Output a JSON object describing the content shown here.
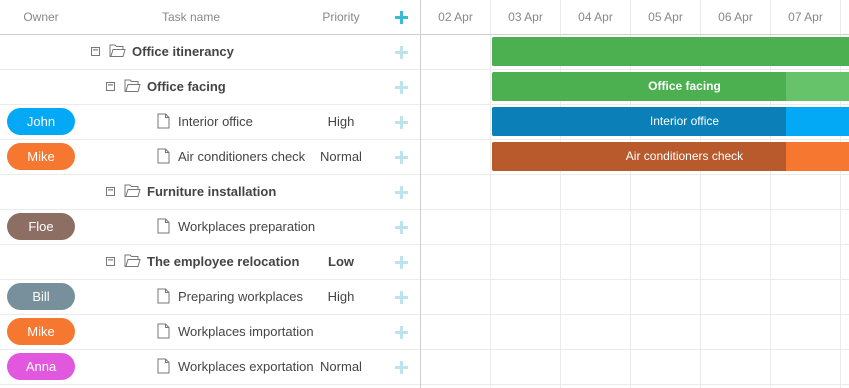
{
  "columns": {
    "owner": "Owner",
    "task_name": "Task name",
    "priority": "Priority"
  },
  "scale_dates": [
    "02 Apr",
    "03 Apr",
    "04 Apr",
    "05 Apr",
    "06 Apr",
    "07 Apr"
  ],
  "tasks": [
    {
      "owner": "",
      "owner_color": "",
      "name": "Office itinerancy",
      "priority": "",
      "type": "folder",
      "level": 0,
      "bold": true
    },
    {
      "owner": "",
      "owner_color": "",
      "name": "Office facing",
      "priority": "",
      "type": "folder",
      "level": 1,
      "bold": true
    },
    {
      "owner": "John",
      "owner_color": "#03a9f4",
      "name": "Interior office",
      "priority": "High",
      "type": "file",
      "level": 2,
      "bold": false
    },
    {
      "owner": "Mike",
      "owner_color": "#f57730",
      "name": "Air conditioners check",
      "priority": "Normal",
      "type": "file",
      "level": 2,
      "bold": false
    },
    {
      "owner": "",
      "owner_color": "",
      "name": "Furniture installation",
      "priority": "",
      "type": "folder",
      "level": 1,
      "bold": true
    },
    {
      "owner": "Floe",
      "owner_color": "#8d6e63",
      "name": "Workplaces preparation",
      "priority": "",
      "type": "file",
      "level": 2,
      "bold": false
    },
    {
      "owner": "",
      "owner_color": "",
      "name": "The employee relocation",
      "priority": "Low",
      "type": "folder",
      "level": 1,
      "bold": true
    },
    {
      "owner": "Bill",
      "owner_color": "#78909c",
      "name": "Preparing workplaces",
      "priority": "High",
      "type": "file",
      "level": 2,
      "bold": false
    },
    {
      "owner": "Mike",
      "owner_color": "#f57730",
      "name": "Workplaces importation",
      "priority": "",
      "type": "file",
      "level": 2,
      "bold": false
    },
    {
      "owner": "Anna",
      "owner_color": "#e157de",
      "name": "Workplaces exportation",
      "priority": "Normal",
      "type": "file",
      "level": 2,
      "bold": false
    }
  ],
  "bars": [
    {
      "row": 0,
      "label": "",
      "color": "#4caf50",
      "progress_color": "#4caf50",
      "start_date": "03 Apr",
      "progress": 1.0
    },
    {
      "row": 1,
      "label": "Office facing",
      "color": "#66c36a",
      "progress_color": "#4caf50",
      "start_date": "03 Apr",
      "progress": 0.82
    },
    {
      "row": 2,
      "label": "Interior office",
      "color": "#03a9f4",
      "progress_color": "#0a7fb8",
      "start_date": "03 Apr",
      "progress": 0.82
    },
    {
      "row": 3,
      "label": "Air conditioners check",
      "color": "#f57730",
      "progress_color": "#b85a2c",
      "start_date": "03 Apr",
      "progress": 0.82
    }
  ]
}
